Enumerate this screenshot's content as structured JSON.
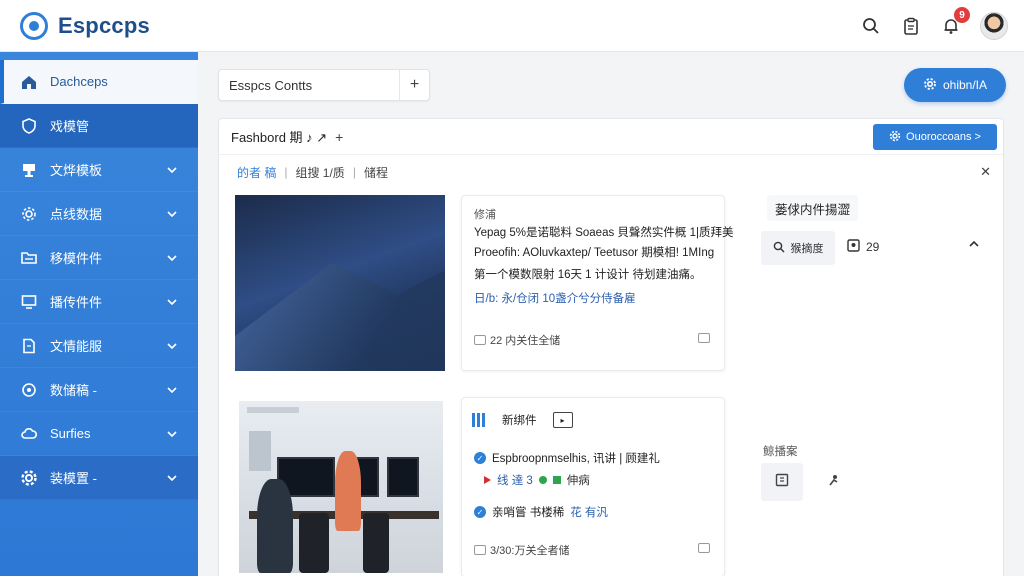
{
  "app": {
    "name": "Espccps"
  },
  "topbar": {
    "notifications_count": "9"
  },
  "sidebar": {
    "items": [
      {
        "label": "Dachceps",
        "icon": "home-icon"
      },
      {
        "label": "戏模管",
        "icon": "shield-icon"
      },
      {
        "label": "文烨模板",
        "icon": "trophy-icon"
      },
      {
        "label": "点线数据",
        "icon": "gear-icon"
      },
      {
        "label": "移模件件",
        "icon": "folder-icon"
      },
      {
        "label": "播传件件",
        "icon": "monitor-icon"
      },
      {
        "label": "文情能服",
        "icon": "document-icon"
      },
      {
        "label": "数储稿 -",
        "icon": "circle-icon"
      },
      {
        "label": "Surfies",
        "icon": "cloud-icon"
      },
      {
        "label": "装模置 -",
        "icon": "settings-icon"
      }
    ]
  },
  "main": {
    "tab_label": "Esspcs Contts",
    "primary_button": "ohibn/IA",
    "panel": {
      "title": "Fashbord 期 ♪ ↗",
      "section_button": "Ouoroccoans >",
      "breadcrumbs": {
        "link": "的者 稿",
        "mid": "组搜 1/质",
        "last": "储程"
      },
      "card1": {
        "title": "修浦",
        "lines": [
          "Yepag 5%是诺聪料 Soaeas 貝聲然实件概 1|质拜美",
          "Proeofih: AOluvkaxtep/ Teetusor 期模相! 1MIng",
          "第一个模数限射 16天 1 计设计 待划建油痛。",
          "日/b: 永/仓闭 10盏介兮分侍备雇"
        ],
        "footer": "22 内关住全储"
      },
      "card2": {
        "toolbar_label": "新绑件",
        "row1": "Espbroopnmselhis, 讯讲 | 顾建礼",
        "row2a": "线 達 3",
        "row2b": "伸病",
        "row3a": "亲哨嘗 书楼稀",
        "row3b": "花 有汎",
        "footer": "3/30:万关全者储"
      },
      "right": {
        "title": "蒌俅内件揚澀",
        "search_label": "猴摘度",
        "count": "29",
        "sub_label": "鲸播案"
      }
    }
  },
  "colors": {
    "accent": "#2f7fd8",
    "sidebar": "#3a86dc",
    "danger": "#e23c3c"
  }
}
